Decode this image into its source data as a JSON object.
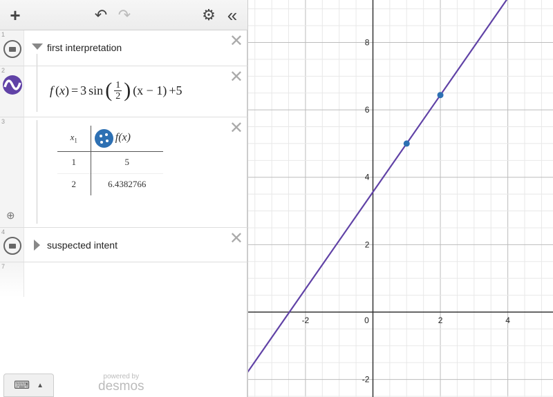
{
  "toolbar": {
    "add": "+",
    "undo": "↶",
    "redo": "↷",
    "settings": "⚙",
    "collapse": "«"
  },
  "expressions": [
    {
      "num": "1",
      "type": "folder",
      "label": "first interpretation",
      "expanded": true
    },
    {
      "num": "2",
      "type": "expression",
      "latex_parts": {
        "lhs": "f",
        "arg": "x",
        "eq": "=",
        "coef": "3",
        "fn": "sin",
        "frac_num": "1",
        "frac_den": "2",
        "rest_open": "(x − 1)",
        "plus": "+5"
      },
      "color": "#6042a6"
    },
    {
      "num": "3",
      "type": "table",
      "headers": [
        "x",
        "f(x)"
      ],
      "header_sub": "1",
      "rows": [
        [
          "1",
          "5"
        ],
        [
          "2",
          "6.4382766"
        ]
      ],
      "color": "#2d70b3"
    },
    {
      "num": "4",
      "type": "folder",
      "label": "suspected intent",
      "expanded": false
    },
    {
      "num": "7",
      "type": "empty"
    }
  ],
  "footer": {
    "powered_by": "powered by",
    "brand": "desmos"
  },
  "chart_data": {
    "type": "line",
    "xlim": [
      -3.72,
      5.34
    ],
    "ylim": [
      -2.52,
      9.26
    ],
    "x_ticks": [
      "-2",
      "0",
      "2",
      "4"
    ],
    "y_ticks": [
      "-2",
      "2",
      "4",
      "6",
      "8"
    ],
    "grid": true,
    "series": [
      {
        "kind": "function",
        "slope": 1.4382766,
        "intercept": 3.5617234,
        "color": "#6042a6"
      },
      {
        "kind": "points",
        "x": [
          1,
          2
        ],
        "y": [
          5,
          6.4382766
        ],
        "color": "#2d70b3"
      }
    ]
  }
}
